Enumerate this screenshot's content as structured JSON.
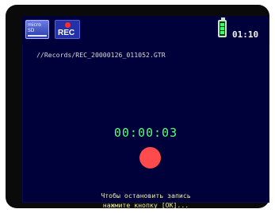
{
  "topbar": {
    "storage_icon_lines": [
      "micro",
      "SD"
    ],
    "rec_label": "REC",
    "battery_level": 0.75,
    "clock": "01:10"
  },
  "recording": {
    "file_path": "//Records/REC_20000126_011052.GTR",
    "elapsed": "00:00:03"
  },
  "hint": {
    "line1": "Чтобы остановить запись",
    "line2": "нажмите кнопку [OK]..."
  },
  "colors": {
    "screen_bg": "#00003a",
    "timer": "#56ff7a",
    "record_dot": "#ff4b4b",
    "hint_text": "#f2f2a0"
  }
}
